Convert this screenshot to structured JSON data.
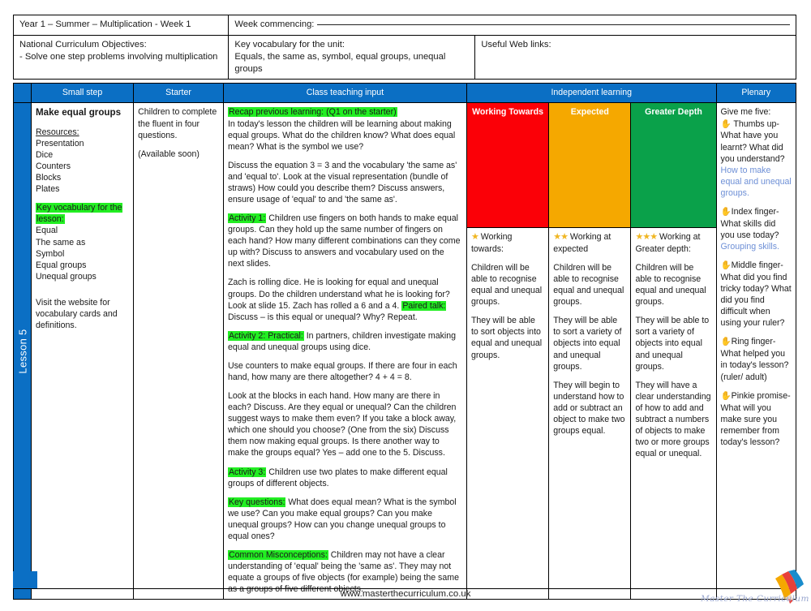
{
  "meta": {
    "title_line": "Year 1 – Summer – Multiplication - Week 1",
    "week_commencing_label": "Week commencing:",
    "nc_objectives_label": "National Curriculum Objectives:",
    "nc_objectives_text": "- Solve one step problems involving multiplication",
    "key_vocab_label": "Key vocabulary for the unit:",
    "key_vocab_text": "Equals, the same as, symbol, equal groups, unequal groups",
    "web_links_label": "Useful Web links:"
  },
  "headers": {
    "small_step": "Small step",
    "starter": "Starter",
    "class_teaching_input": "Class teaching input",
    "independent_learning": "Independent learning",
    "plenary": "Plenary"
  },
  "lesson_spine": "Lesson 5",
  "small_step": {
    "title": "Make equal groups",
    "resources_label": "Resources:",
    "resources": [
      "Presentation",
      "Dice",
      "Counters",
      "Blocks",
      "Plates"
    ],
    "key_vocab_label": "Key vocabulary for the lesson:",
    "key_vocab": [
      "Equal",
      "The same as",
      "Symbol",
      "Equal groups",
      "Unequal groups"
    ],
    "note": "Visit the website for vocabulary cards and definitions."
  },
  "starter": {
    "line1": "Children to complete the fluent in four questions.",
    "line2": "(Available soon)"
  },
  "class_teaching": {
    "blocks": [
      {
        "highlight": "Recap previous learning: (Q1 on the starter)",
        "text": "In today's lesson the children will be learning about making equal groups. What do the children know? What does equal mean? What is the symbol we use?"
      },
      {
        "highlight": "",
        "text": "Discuss the equation 3 = 3 and the vocabulary 'the same as' and 'equal to'. Look at the visual representation (bundle of straws) How could you describe them? Discuss answers, ensure usage of 'equal' to and 'the same as'."
      },
      {
        "highlight": "Activity 1:",
        "text": " Children use fingers on both hands to make equal groups. Can they hold up the same number of fingers on each hand? How many different combinations can they come up with? Discuss to answers and vocabulary used on the next slides."
      },
      {
        "highlight": "",
        "text_before": "Zach is rolling dice. He is looking for equal and unequal groups. Do the children understand what he is looking for? Look at slide 15. Zach has rolled a 6 and a 4. ",
        "inline_highlight": "Paired talk:",
        "text_after": " Discuss – is this equal or unequal? Why? Repeat."
      },
      {
        "highlight": "Activity 2: Practical:",
        "text": " In partners, children investigate making equal and unequal groups using dice."
      },
      {
        "highlight": "",
        "text": "Use counters to make equal groups. If there are four in each hand, how many are there altogether? 4 + 4 = 8."
      },
      {
        "highlight": "",
        "text": "Look at the blocks in each hand. How many are there in each? Discuss. Are they equal or unequal? Can the children suggest ways to make them even? If you take a block away, which one should you choose? (One from the six) Discuss them now making equal groups. Is there another way to make the groups equal? Yes – add one to the 5. Discuss."
      },
      {
        "highlight": "Activity 3:",
        "text": " Children use two plates to make different equal groups of different objects."
      },
      {
        "highlight": "Key questions:",
        "text": " What does equal mean? What is the symbol we use? Can you make equal groups? Can you make unequal groups? How can you change unequal groups to equal ones?"
      },
      {
        "highlight": "Common Misconceptions:",
        "text": " Children may not have a clear understanding of 'equal' being the 'same as'. They may not equate a groups of five objects (for example) being the same as a groups of five different objects."
      }
    ]
  },
  "independent": {
    "columns": [
      {
        "header": "Working Towards",
        "header_color": "#fb0007",
        "stars": "★",
        "heading": "Working towards:",
        "paragraphs": [
          "Children will be able to recognise equal and unequal groups.",
          "They will be able to sort objects into equal and unequal groups."
        ]
      },
      {
        "header": "Expected",
        "header_color": "#f5a800",
        "stars": "★★",
        "heading": "Working at expected",
        "paragraphs": [
          "Children will be able to recognise equal and unequal groups.",
          "They will be able to sort a variety of objects into equal and unequal groups.",
          "They will begin to understand how to add or subtract an object to make two groups equal."
        ]
      },
      {
        "header": "Greater Depth",
        "header_color": "#0aa14a",
        "stars": "★★★",
        "heading": "Working at Greater depth:",
        "paragraphs": [
          "Children will be able to recognise equal and unequal groups.",
          "They will be able to sort a variety of objects into equal and unequal groups.",
          "They will have a clear understanding of how to add and subtract a numbers of objects to make two or more groups equal or unequal."
        ]
      }
    ]
  },
  "plenary": {
    "intro": "Give me five:",
    "items": [
      {
        "hand": "✋",
        "question": "Thumbs up- What have you learnt? What did you understand?",
        "answer": "How to make equal and unequal groups."
      },
      {
        "hand": "✋",
        "question": "Index finger- What skills did you use today?",
        "answer": "Grouping skills."
      },
      {
        "hand": "✋",
        "question": "Middle finger- What did you find tricky today? What did you find difficult when using your ruler?",
        "answer": ""
      },
      {
        "hand": "✋",
        "question": "Ring finger- What helped you in today's lesson? (ruler/ adult)",
        "answer": ""
      },
      {
        "hand": "✋",
        "question": "Pinkie promise- What will you make sure you remember from today's lesson?",
        "answer": ""
      }
    ]
  },
  "footer": {
    "site_url": "www.masterthecurriculum.co.uk",
    "logo_text": "Master The Curriculum"
  },
  "colors": {
    "brand_blue": "#0b6fc4",
    "highlight_green": "#22ee22",
    "working_towards": "#fb0007",
    "expected": "#f5a800",
    "greater_depth": "#0aa14a",
    "answer_blue": "#6d8fd6"
  }
}
